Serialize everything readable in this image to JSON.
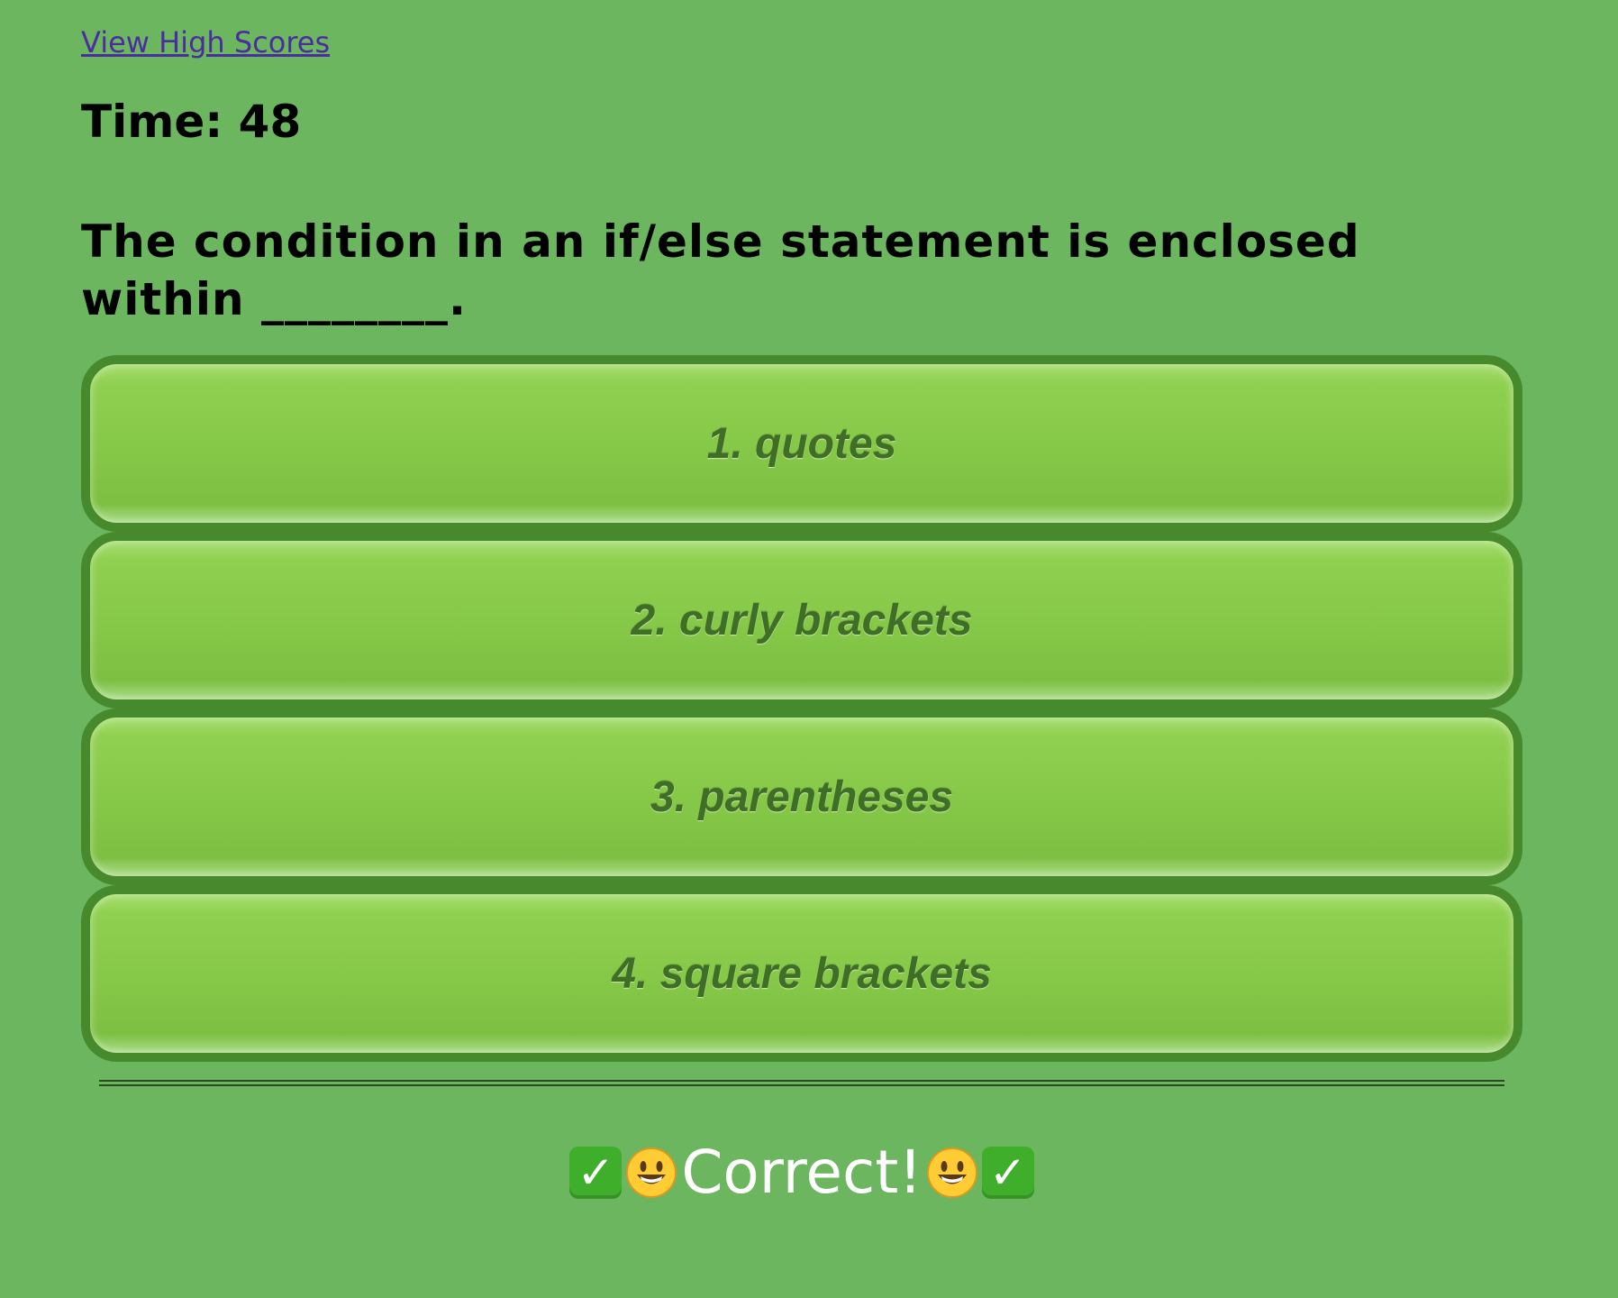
{
  "header": {
    "high_scores_link": "View High Scores",
    "timer_label": "Time: 48"
  },
  "quiz": {
    "question": "The condition in an if/else statement is enclosed within ________.",
    "answers": [
      {
        "label": "1. quotes"
      },
      {
        "label": "2. curly brackets"
      },
      {
        "label": "3. parentheses"
      },
      {
        "label": "4. square brackets"
      }
    ]
  },
  "feedback": {
    "text": "Correct!",
    "icons": [
      "check-mark-icon",
      "smiley-icon",
      "smiley-icon",
      "check-mark-icon"
    ]
  },
  "colors": {
    "background": "#6bb65f",
    "button_border": "#478a2e",
    "button_fill": "#84c646",
    "button_text": "#3f6e26",
    "link": "#4b2e9e",
    "feedback_text": "#ffffff"
  }
}
